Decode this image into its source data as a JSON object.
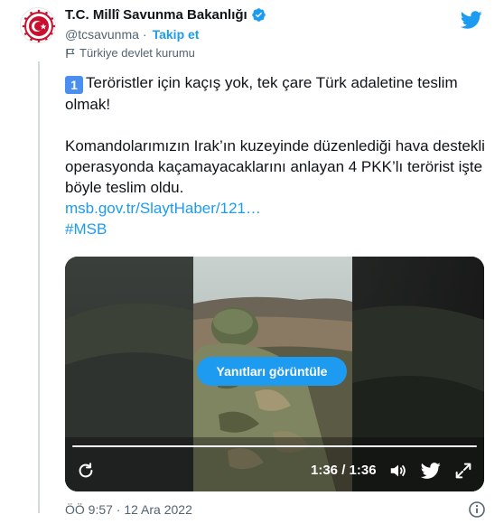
{
  "tweet": {
    "author": {
      "display_name": "T.C. Millî Savunma Bakanlığı",
      "handle": "@tcsavunma",
      "follow_label": "Takip et",
      "separator": "·",
      "affiliation_label": "Türkiye devlet kurumu",
      "verified": true
    },
    "text": {
      "emoji_number": "1",
      "line1": "Teröristler için kaçış yok, tek çare Türk adaletine teslim olmak!",
      "line2": "Komandolarımızın Irak’ın kuzeyinde düzenlediği hava destekli operasyonda kaçamayacaklarını anlayan 4 PKK’lı terörist işte böyle teslim oldu.",
      "link": "msb.gov.tr/SlaytHaber/121…",
      "hashtag": "#MSB"
    },
    "video": {
      "overlay_button": "Yanıtları görüntüle",
      "time_display": "1:36 / 1:36",
      "progress": 1.0
    },
    "footer": {
      "timestamp": "ÖÖ 9:57 · 12 Ara 2022"
    }
  },
  "colors": {
    "accent": "#1d9bf0",
    "text": "#0f1419",
    "muted": "#536471"
  },
  "icons": [
    "ministry-emblem-icon",
    "verified-badge-icon",
    "flag-icon",
    "twitter-bird-icon",
    "replay-icon",
    "volume-icon",
    "twitter-share-icon",
    "fullscreen-icon",
    "info-icon"
  ]
}
